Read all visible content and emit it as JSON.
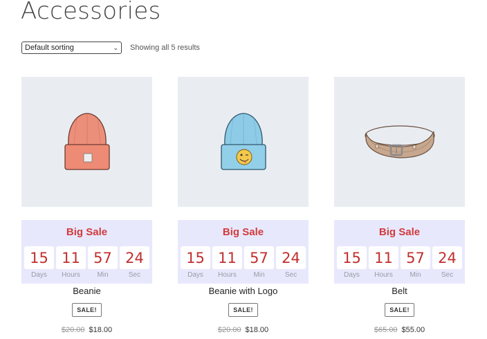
{
  "page_title": "Accessories",
  "sorting": {
    "selected": "Default sorting"
  },
  "result_count": "Showing all 5 results",
  "countdown_labels": {
    "days": "Days",
    "hours": "Hours",
    "min": "Min",
    "sec": "Sec"
  },
  "products": [
    {
      "name": "Beanie",
      "image_icon": "beanie-icon",
      "sale_title": "Big Sale",
      "countdown": {
        "days": "15",
        "hours": "11",
        "min": "57",
        "sec": "24"
      },
      "badge": "SALE!",
      "old_price": "$20.00",
      "new_price": "$18.00"
    },
    {
      "name": "Beanie with Logo",
      "image_icon": "beanie-with-logo-icon",
      "sale_title": "Big Sale",
      "countdown": {
        "days": "15",
        "hours": "11",
        "min": "57",
        "sec": "24"
      },
      "badge": "SALE!",
      "old_price": "$20.00",
      "new_price": "$18.00"
    },
    {
      "name": "Belt",
      "image_icon": "belt-icon",
      "sale_title": "Big Sale",
      "countdown": {
        "days": "15",
        "hours": "11",
        "min": "57",
        "sec": "24"
      },
      "badge": "SALE!",
      "old_price": "$65.00",
      "new_price": "$55.00"
    }
  ],
  "colors": {
    "sale_red": "#d03b3b",
    "countdown_bg": "#e8e8fd",
    "image_bg": "#e9edf2"
  }
}
